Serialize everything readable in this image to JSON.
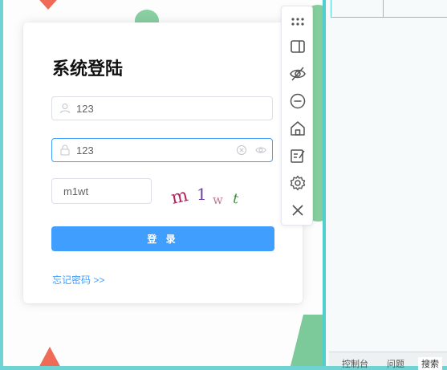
{
  "login": {
    "title": "系统登陆",
    "username": {
      "value": "123",
      "placeholder": ""
    },
    "password": {
      "value": "123",
      "placeholder": ""
    },
    "captcha": {
      "value": "m1wt",
      "image_text": [
        "m",
        "1",
        "w",
        "t"
      ],
      "image_colors": [
        "#b3235b",
        "#6b3fa0",
        "#c47a9a",
        "#3f8f3a"
      ]
    },
    "login_button": "登 录",
    "forgot_link": "忘记密码 >>"
  },
  "toolbar": {
    "buttons": [
      "drag-handle-icon",
      "split-panel-icon",
      "eye-off-icon",
      "minus-circle-icon",
      "home-icon",
      "edit-note-icon",
      "gear-icon",
      "close-icon"
    ]
  },
  "devtools": {
    "tabs": [
      "控制台",
      "问题",
      "搜索"
    ],
    "active_tab": "搜索"
  },
  "colors": {
    "primary": "#409eff",
    "accent_teal": "#4fd0cf",
    "deco_red": "#ef6b57",
    "deco_green": "#85cd9d"
  }
}
